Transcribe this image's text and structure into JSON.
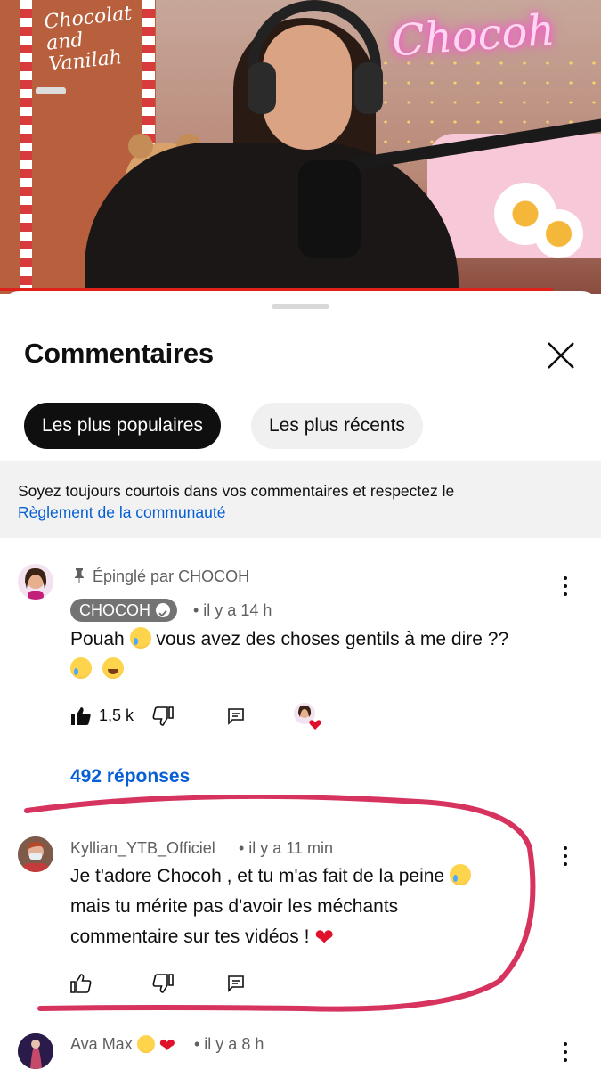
{
  "video": {
    "door_text": "Chocolat and Vanilah",
    "neon_text": "Chocoh",
    "progress_fraction": 0.92
  },
  "sheet": {
    "title": "Commentaires",
    "close_icon": "close-icon"
  },
  "sort_chips": [
    {
      "label": "Les plus populaires",
      "active": true
    },
    {
      "label": "Les plus récents",
      "active": false
    }
  ],
  "notice": {
    "text": "Soyez toujours courtois dans vos commentaires et respectez le",
    "link": "Règlement de la communauté"
  },
  "comments": [
    {
      "pinned_label": "Épinglé par CHOCOH",
      "author": "CHOCOH",
      "verified": true,
      "time": "• il y a 14 h",
      "text_part1": "Pouah",
      "text_part2": "vous avez des choses gentils à me dire ??",
      "likes": "1,5 k",
      "liked": true,
      "creator_heart": true,
      "replies": "492 réponses"
    },
    {
      "author": "Kyllian_YTB_Officiel",
      "time": "• il y a 11 min",
      "text_line1": "Je t'adore Chocoh , et tu m'as fait de la peine",
      "text_line2": "mais tu mérite pas d'avoir les méchants",
      "text_line3": "commentaire sur tes vidéos !"
    },
    {
      "author": "Ava Max",
      "time": "• il y a 8 h"
    }
  ],
  "colors": {
    "accent_link": "#065fd4",
    "progress": "#e0201a",
    "annotation": "#d6345f"
  }
}
